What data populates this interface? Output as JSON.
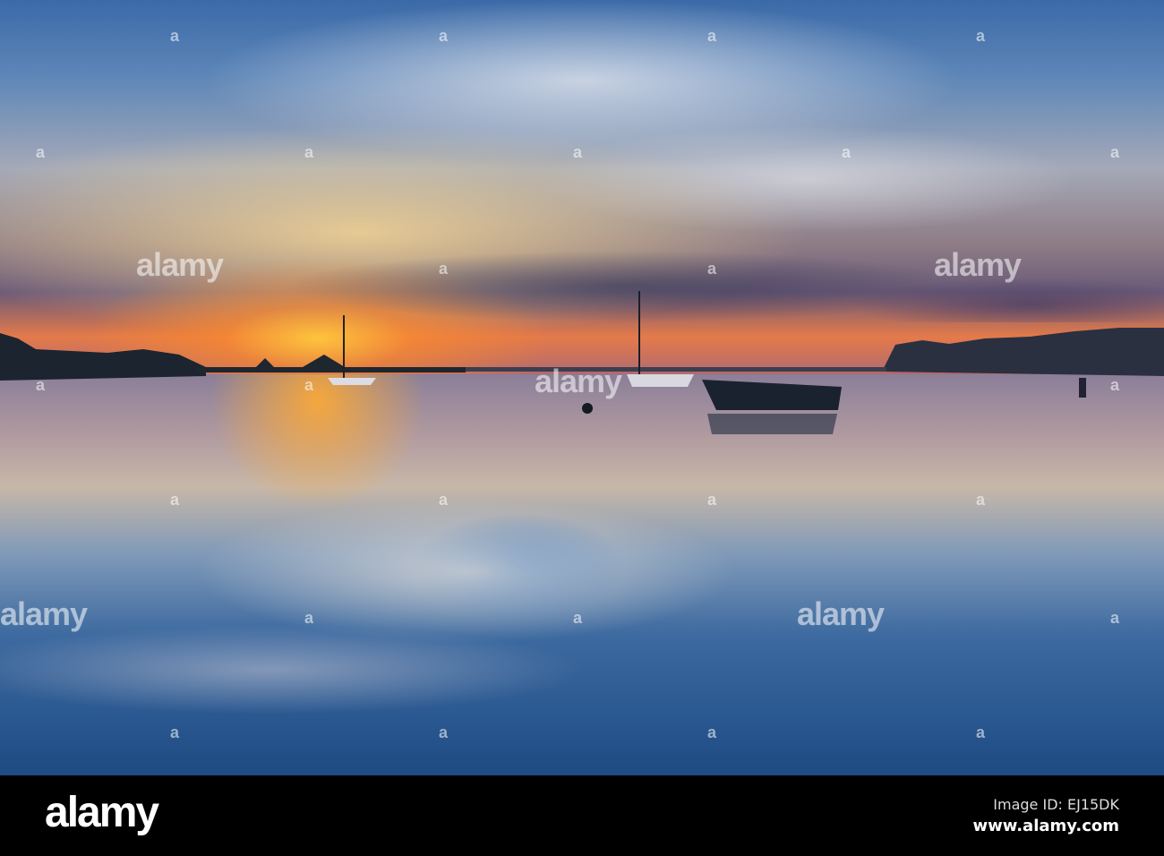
{
  "photo": {
    "description_alt": "Sunset over harbor with sailboats"
  },
  "watermark": {
    "text": "alamy",
    "mark": "a"
  },
  "footer": {
    "logo": "alamy",
    "image_id": "Image ID: EJ15DK",
    "website": "www.alamy.com"
  }
}
